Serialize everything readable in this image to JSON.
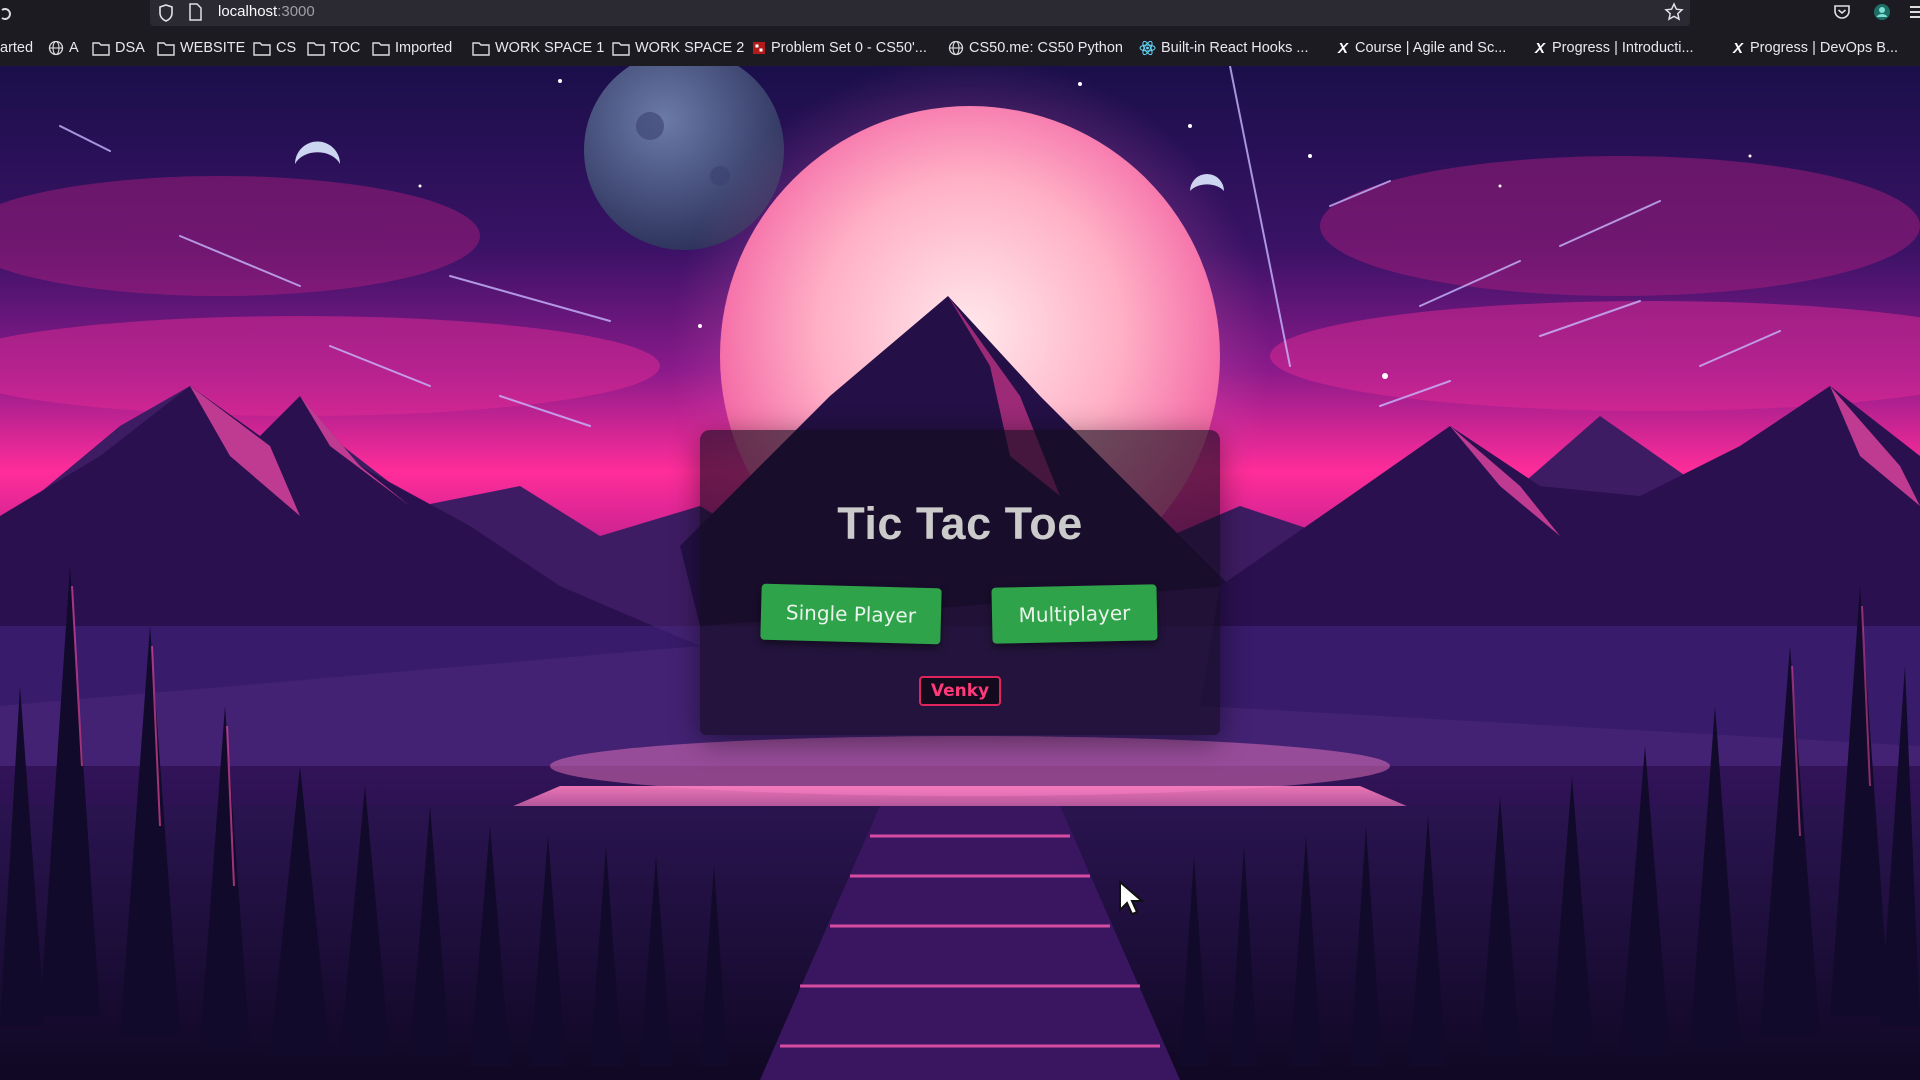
{
  "browser": {
    "url_host": "localhost",
    "url_port": ":3000"
  },
  "bookmarks": [
    {
      "label": "arted",
      "icon": "none"
    },
    {
      "label": "A",
      "icon": "globe-icon"
    },
    {
      "label": "DSA",
      "icon": "folder-icon"
    },
    {
      "label": "WEBSITE",
      "icon": "folder-icon"
    },
    {
      "label": "CS",
      "icon": "folder-icon"
    },
    {
      "label": "TOC",
      "icon": "folder-icon"
    },
    {
      "label": "Imported",
      "icon": "folder-icon"
    },
    {
      "label": "WORK SPACE 1",
      "icon": "folder-icon"
    },
    {
      "label": "WORK SPACE 2",
      "icon": "folder-icon"
    },
    {
      "label": "Problem Set 0 - CS50'...",
      "icon": "cs50-icon"
    },
    {
      "label": "CS50.me: CS50 Python",
      "icon": "globe-icon"
    },
    {
      "label": "Built-in React Hooks ...",
      "icon": "react-icon"
    },
    {
      "label": "Course | Agile and Sc...",
      "icon": "x-icon"
    },
    {
      "label": "Progress | Introducti...",
      "icon": "x-icon"
    },
    {
      "label": "Progress | DevOps B...",
      "icon": "x-icon"
    }
  ],
  "game": {
    "title": "Tic Tac Toe",
    "single_player_label": "Single Player",
    "multiplayer_label": "Multiplayer",
    "username": "Venky"
  },
  "colors": {
    "button_green": "#2fa34a",
    "badge_pink": "#e0245e",
    "sky_magenta": "#ff2d9a"
  }
}
